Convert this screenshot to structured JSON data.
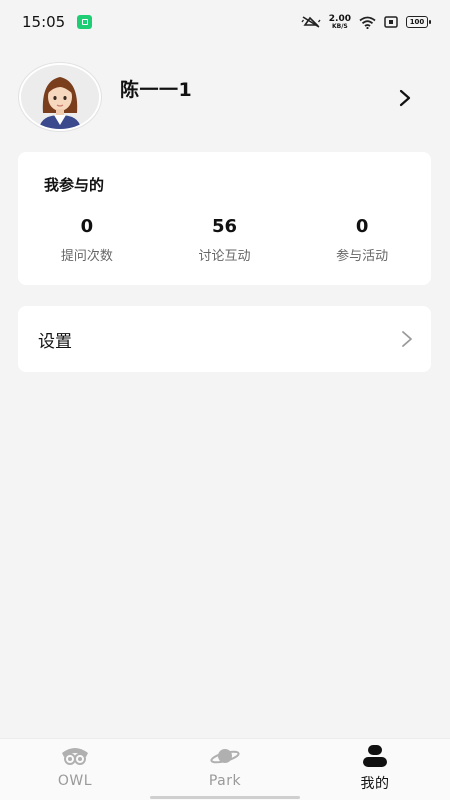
{
  "status_bar": {
    "time": "15:05",
    "net_speed_value": "2.00",
    "net_speed_unit": "KB/S",
    "battery": "100",
    "app_icon_color": "#1fce74"
  },
  "profile": {
    "username": "陈一一1",
    "avatar": "avatar-girl-icon",
    "arrow": "chevron-right-icon"
  },
  "participation": {
    "title": "我参与的",
    "stats": [
      {
        "value": "0",
        "label": "提问次数"
      },
      {
        "value": "56",
        "label": "讨论互动"
      },
      {
        "value": "0",
        "label": "参与活动"
      }
    ]
  },
  "settings": {
    "label": "设置",
    "chevron": "chevron-right-icon"
  },
  "tabs": [
    {
      "label": "OWL",
      "icon": "owl-icon",
      "active": false
    },
    {
      "label": "Park",
      "icon": "planet-icon",
      "active": false
    },
    {
      "label": "我的",
      "icon": "person-icon",
      "active": true
    }
  ],
  "colors": {
    "background": "#f4f4f4",
    "card": "#ffffff",
    "muted_text": "#666666",
    "inactive_tab": "#9a9a9a"
  }
}
